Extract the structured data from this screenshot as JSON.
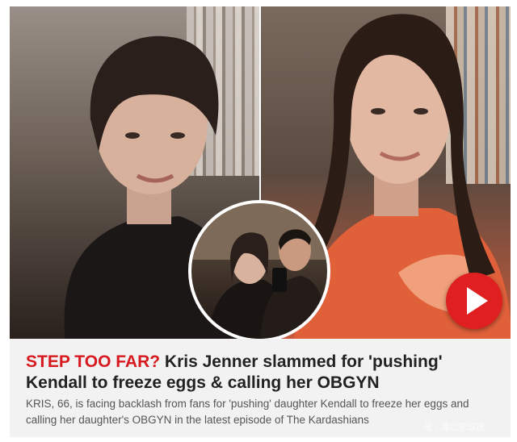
{
  "article": {
    "kicker": "STEP TOO FAR?",
    "headline": " Kris Jenner slammed for 'pushing' Kendall to freeze eggs & calling her OBGYN",
    "standfirst": "KRIS, 66, is facing backlash from fans for 'pushing' daughter Kendall to freeze her eggs and calling her daughter's OBGYN in the latest episode of The Kardashians",
    "watermark": "号 / 湖北老球迷"
  },
  "media": {
    "play_icon": "play-icon",
    "accent_color": "#e02020",
    "kicker_color": "#d71920"
  }
}
